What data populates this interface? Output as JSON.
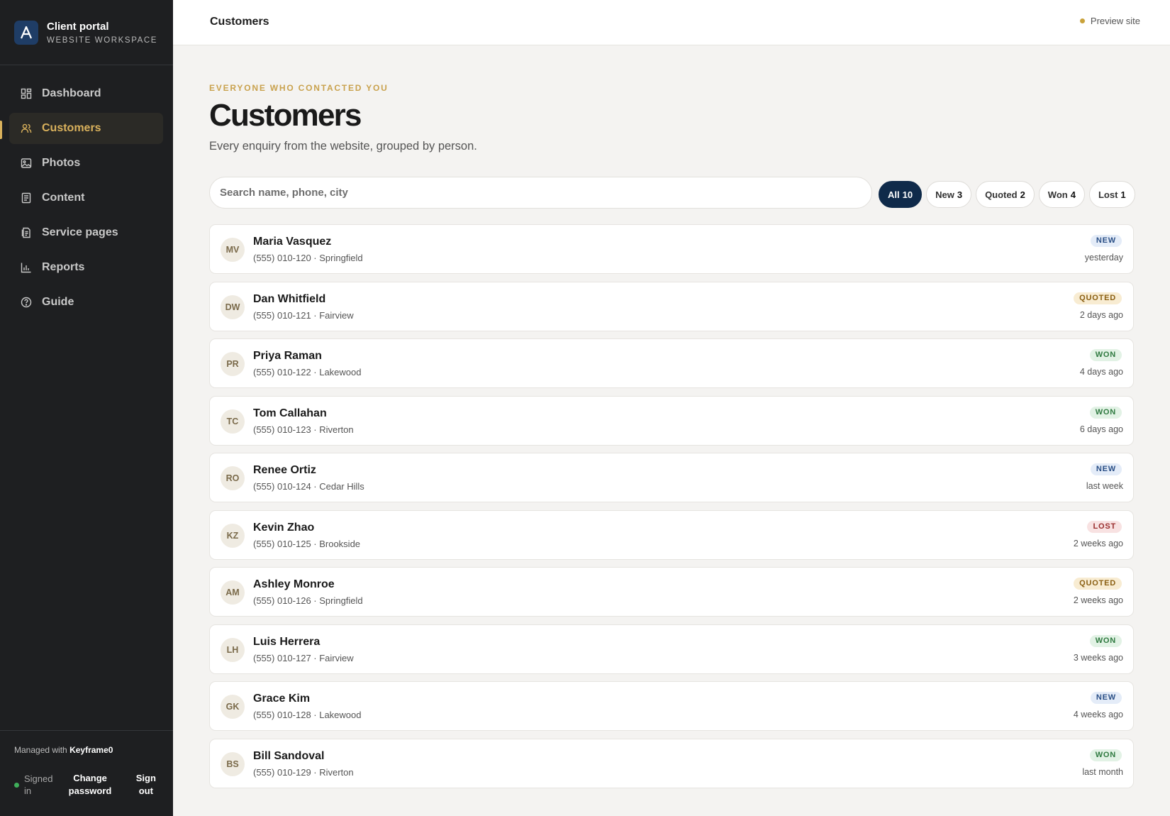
{
  "brand": {
    "logo_letter": "A",
    "title": "Client portal",
    "subtitle": "WEBSITE WORKSPACE"
  },
  "sidebar": {
    "items": [
      {
        "label": "Dashboard",
        "icon": "dashboard-icon"
      },
      {
        "label": "Customers",
        "icon": "users-icon",
        "active": true
      },
      {
        "label": "Photos",
        "icon": "image-icon"
      },
      {
        "label": "Content",
        "icon": "document-icon"
      },
      {
        "label": "Service pages",
        "icon": "pages-icon"
      },
      {
        "label": "Reports",
        "icon": "bar-chart-icon"
      },
      {
        "label": "Guide",
        "icon": "help-circle-icon"
      }
    ],
    "footer": {
      "managed_prefix": "Managed with",
      "managed_brand": "Keyframe0",
      "signed_in": "Signed in",
      "change_password": "Change password",
      "sign_out": "Sign out"
    }
  },
  "topbar": {
    "title": "Customers",
    "preview": "Preview site"
  },
  "main": {
    "eyebrow": "EVERYONE WHO CONTACTED YOU",
    "title": "Customers",
    "subtitle": "Every enquiry from the website, grouped by person.",
    "search": {
      "placeholder": "Search name, phone, city",
      "value": ""
    },
    "filters": [
      {
        "label": "All",
        "count": "10",
        "active": true
      },
      {
        "label": "New",
        "count": "3"
      },
      {
        "label": "Quoted",
        "count": "2"
      },
      {
        "label": "Won",
        "count": "4"
      },
      {
        "label": "Lost",
        "count": "1"
      }
    ],
    "customers": [
      {
        "initials": "MV",
        "name": "Maria Vasquez",
        "meta": "(555) 010-120 · Springfield",
        "status": "NEW",
        "when": "yesterday"
      },
      {
        "initials": "DW",
        "name": "Dan Whitfield",
        "meta": "(555) 010-121 · Fairview",
        "status": "QUOTED",
        "when": "2 days ago"
      },
      {
        "initials": "PR",
        "name": "Priya Raman",
        "meta": "(555) 010-122 · Lakewood",
        "status": "WON",
        "when": "4 days ago"
      },
      {
        "initials": "TC",
        "name": "Tom Callahan",
        "meta": "(555) 010-123 · Riverton",
        "status": "WON",
        "when": "6 days ago"
      },
      {
        "initials": "RO",
        "name": "Renee Ortiz",
        "meta": "(555) 010-124 · Cedar Hills",
        "status": "NEW",
        "when": "last week"
      },
      {
        "initials": "KZ",
        "name": "Kevin Zhao",
        "meta": "(555) 010-125 · Brookside",
        "status": "LOST",
        "when": "2 weeks ago"
      },
      {
        "initials": "AM",
        "name": "Ashley Monroe",
        "meta": "(555) 010-126 · Springfield",
        "status": "QUOTED",
        "when": "2 weeks ago"
      },
      {
        "initials": "LH",
        "name": "Luis Herrera",
        "meta": "(555) 010-127 · Fairview",
        "status": "WON",
        "when": "3 weeks ago"
      },
      {
        "initials": "GK",
        "name": "Grace Kim",
        "meta": "(555) 010-128 · Lakewood",
        "status": "NEW",
        "when": "4 weeks ago"
      },
      {
        "initials": "BS",
        "name": "Bill Sandoval",
        "meta": "(555) 010-129 · Riverton",
        "status": "WON",
        "when": "last month"
      }
    ]
  },
  "colors": {
    "sidebar_bg": "#1e1f21",
    "accent_gold": "#d9b15c",
    "brand_blue": "#1f3d66",
    "active_pill": "#0f2a4a",
    "status_new": "#2a4f86",
    "status_quoted": "#8a5f12",
    "status_won": "#2f7a40",
    "status_lost": "#9a2e2e"
  }
}
